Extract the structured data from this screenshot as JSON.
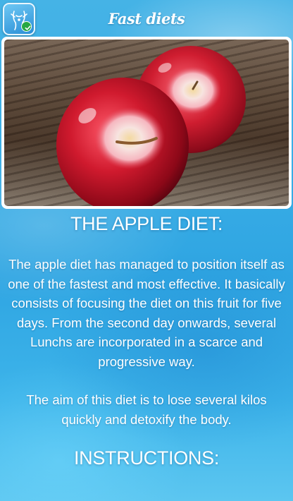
{
  "header": {
    "title": "Fast diets",
    "app_icon": "diet-app-icon",
    "badge_icon": "check-icon"
  },
  "hero_image": {
    "subject": "red-apples-on-wood"
  },
  "article": {
    "heading": "THE APPLE DIET:",
    "paragraph1": "The apple diet has managed to position itself as one of the fastest and most effective. It basically consists of focusing the diet on this fruit for five days. From the second day onwards, several Lunchs are incorporated in a scarce and progressive way.",
    "paragraph2": "The aim of this diet is to lose several kilos quickly and detoxify the body.",
    "instructions_heading": "INSTRUCTIONS:"
  },
  "colors": {
    "background": "#3aaee6",
    "text": "#ffffff",
    "badge": "#27a844"
  }
}
